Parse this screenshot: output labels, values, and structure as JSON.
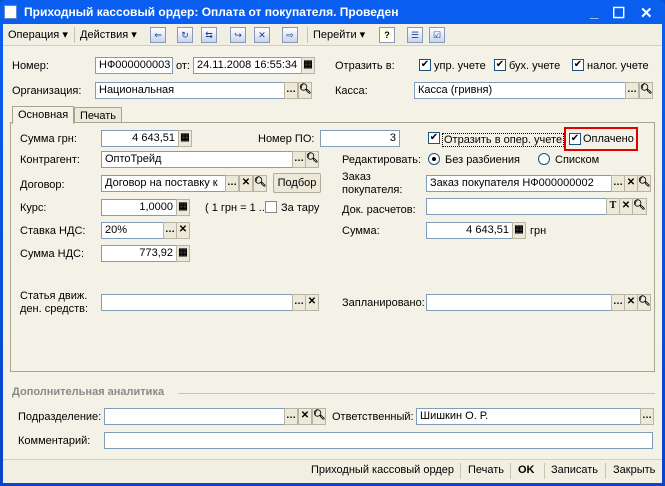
{
  "window": {
    "title": "Приходный кассовый ордер: Оплата от покупателя. Проведен"
  },
  "toolbar": {
    "operation": "Операция ▾",
    "actions": "Действия ▾",
    "goto": "Перейти ▾",
    "help": "?"
  },
  "header": {
    "number_label": "Номер:",
    "number": "НФ000000003",
    "from_label": "от:",
    "date": "24.11.2008 16:55:34",
    "reflect_label": "Отразить в:",
    "reflect_upr": "упр. учете",
    "reflect_buh": "бух. учете",
    "reflect_nalog": "налог. учете",
    "org_label": "Организация:",
    "org": "Национальная",
    "kassa_label": "Касса:",
    "kassa": "Касса (гривня)"
  },
  "tabs": [
    "Основная",
    "Печать"
  ],
  "main": {
    "sum_label": "Сумма грн:",
    "sum": "4 643,51",
    "po_label": "Номер ПО:",
    "po": "3",
    "oper_label": "Отразить в опер. учете",
    "paid_label": "Оплачено",
    "contr_label": "Контрагент:",
    "contr": "ОптоТрейд",
    "edit_label": "Редактировать:",
    "edit_opt1": "Без разбиения",
    "edit_opt2": "Списком",
    "dogovor_label": "Договор:",
    "dogovor": "Договор на поставку к",
    "podbor": "Подбор",
    "order_label": "Заказ покупателя:",
    "order": "Заказ покупателя НФ000000002",
    "kurs_label": "Курс:",
    "kurs": "1,0000",
    "kurs_note": "( 1 грн = 1 ..",
    "tara_label": "За тару",
    "dok_label": "Док. расчетов:",
    "dok": "",
    "nds_rate_label": "Ставка НДС:",
    "nds_rate": "20%",
    "summa_label": "Сумма:",
    "summa": "4 643,51",
    "currency": "грн",
    "nds_sum_label": "Сумма НДС:",
    "nds_sum": "773,92",
    "statya_label": "Статья движ. ден. средств:",
    "statya": "",
    "planned_label": "Запланировано:",
    "planned": ""
  },
  "extra": {
    "title": "Дополнительная аналитика",
    "dept_label": "Подразделение:",
    "dept": "",
    "resp_label": "Ответственный:",
    "resp": "Шишкин О. Р.",
    "comment_label": "Комментарий:",
    "comment": ""
  },
  "bottom": {
    "pko": "Приходный кассовый ордер",
    "print": "Печать",
    "ok": "OK",
    "save": "Записать",
    "close": "Закрыть"
  },
  "colors": {
    "highlight": "#e00000",
    "title_bar": "#0a5ff0"
  }
}
